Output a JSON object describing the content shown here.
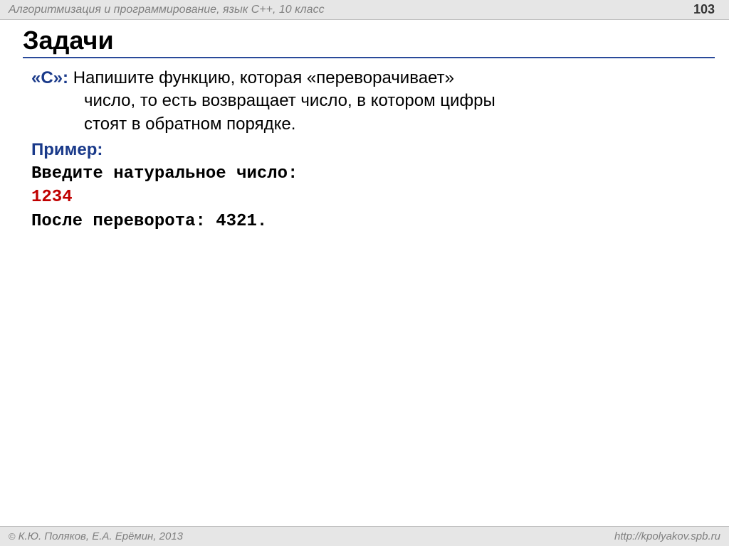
{
  "header": {
    "title": "Алгоритмизация и программирование, язык  C++, 10 класс",
    "page_number": "103"
  },
  "slide": {
    "title": "Задачи",
    "task_label": "«C»:",
    "task_text_line1": " Напишите функцию, которая «переворачивает»",
    "task_text_line2": "число, то есть возвращает число, в котором цифры",
    "task_text_line3": "стоят в обратном порядке.",
    "example_label": "Пример:",
    "mono_line1": "Введите натуральное число:",
    "mono_line2": "1234",
    "mono_line3": "После переворота: 4321."
  },
  "footer": {
    "copyright": " К.Ю. Поляков, Е.А. Ерёмин, 2013",
    "url": "http://kpolyakov.spb.ru"
  }
}
